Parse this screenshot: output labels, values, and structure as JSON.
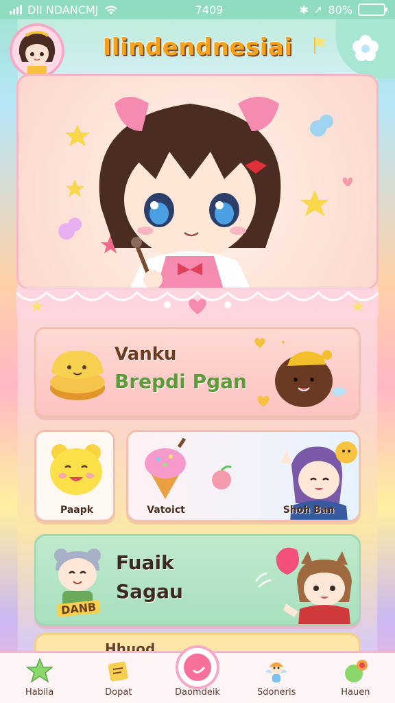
{
  "status_bar": {
    "carrier": "DII NDANCMJ",
    "time": "7409",
    "battery_percent": "80%",
    "battery_level": 0.8
  },
  "header": {
    "title": "Ilindendnesiai"
  },
  "cards": {
    "breads": {
      "line1": "Vanku",
      "line2": "Brepdi Pgan"
    },
    "small_1": {
      "label": "Paapk"
    },
    "small_2": {
      "label_left": "Vatoict",
      "label_right": "Shoh Ban"
    },
    "green": {
      "line1": "Fuaik",
      "line2": "Sagau",
      "tag": "DANB"
    },
    "bottom": {
      "line1": "Hhuod"
    }
  },
  "nav": {
    "items": [
      {
        "label": "Habila",
        "icon": "star-icon"
      },
      {
        "label": "Dopat",
        "icon": "note-icon"
      },
      {
        "label": "Daomdeik",
        "icon": "play-icon"
      },
      {
        "label": "Sdoneris",
        "icon": "fairy-icon"
      },
      {
        "label": "Hauen",
        "icon": "ribbon-icon"
      }
    ]
  },
  "colors": {
    "accent_pink": "#f7a8c6",
    "mint": "#8fdcc0",
    "title_orange": "#f6a11a",
    "brown_text": "#6a3e20",
    "green_text": "#5c9a3a"
  }
}
